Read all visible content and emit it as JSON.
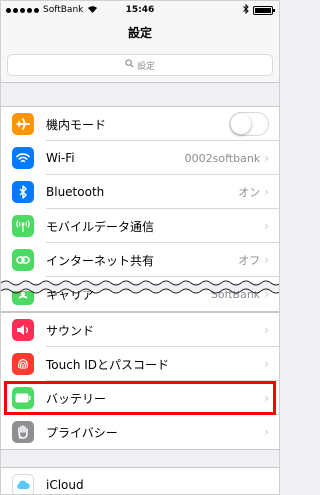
{
  "status_bar": {
    "carrier": "SoftBank",
    "time": "15:46"
  },
  "nav": {
    "title": "設定"
  },
  "search": {
    "placeholder": "設定"
  },
  "group1": [
    {
      "label": "機内モード",
      "value": "",
      "icon": "airplane-icon",
      "color": "#ff9500",
      "control": "toggle",
      "toggle_on": false
    },
    {
      "label": "Wi-Fi",
      "value": "0002softbank",
      "icon": "wifi-icon",
      "color": "#007aff",
      "control": "chevron"
    },
    {
      "label": "Bluetooth",
      "value": "オン",
      "icon": "bluetooth-icon",
      "color": "#007aff",
      "control": "chevron"
    },
    {
      "label": "モバイルデータ通信",
      "value": "",
      "icon": "cellular-icon",
      "color": "#4cd964",
      "control": "chevron"
    },
    {
      "label": "インターネット共有",
      "value": "オフ",
      "icon": "hotspot-icon",
      "color": "#4cd964",
      "control": "chevron"
    },
    {
      "label": "キャリア",
      "value": "SoftBank",
      "icon": "carrier-icon",
      "color": "#4cd964",
      "control": "chevron"
    }
  ],
  "group2": [
    {
      "label": "サウンド",
      "value": "",
      "icon": "sound-icon",
      "color": "#ff2d55",
      "control": "chevron"
    },
    {
      "label": "Touch IDとパスコード",
      "value": "",
      "icon": "fingerprint-icon",
      "color": "#ff3b30",
      "control": "chevron"
    },
    {
      "label": "バッテリー",
      "value": "",
      "icon": "battery-icon",
      "color": "#4cd964",
      "control": "chevron"
    },
    {
      "label": "プライバシー",
      "value": "",
      "icon": "privacy-hand-icon",
      "color": "#8e8e93",
      "control": "chevron"
    }
  ],
  "group3": [
    {
      "label": "iCloud",
      "value": "",
      "icon": "icloud-icon",
      "color": "#ffffff",
      "control": "none"
    }
  ],
  "highlight_color": "#ff0000"
}
